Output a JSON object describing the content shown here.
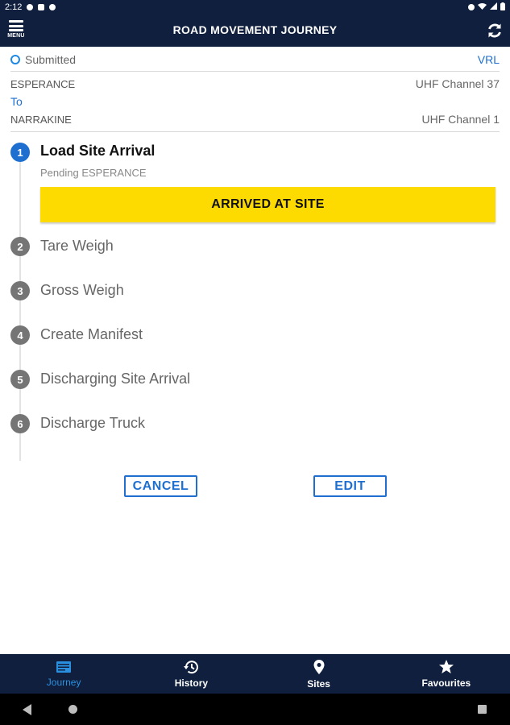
{
  "status_bar": {
    "time": "2:12"
  },
  "header": {
    "menu_label": "MENU",
    "title": "ROAD MOVEMENT JOURNEY"
  },
  "journey": {
    "status": "Submitted",
    "company": "VRL",
    "origin": "ESPERANCE",
    "origin_channel": "UHF Channel 37",
    "to_label": "To",
    "destination": "NARRAKINE",
    "destination_channel": "UHF Channel 1"
  },
  "steps": [
    {
      "number": "1",
      "title": "Load Site Arrival",
      "subtitle": "Pending ESPERANCE",
      "action": "ARRIVED AT SITE"
    },
    {
      "number": "2",
      "title": "Tare Weigh"
    },
    {
      "number": "3",
      "title": "Gross Weigh"
    },
    {
      "number": "4",
      "title": "Create Manifest"
    },
    {
      "number": "5",
      "title": "Discharging Site Arrival"
    },
    {
      "number": "6",
      "title": "Discharge Truck"
    }
  ],
  "actions": {
    "cancel_label": "CANCEL",
    "edit_label": "EDIT"
  },
  "bottom_nav": [
    {
      "label": "Journey",
      "icon": "journey-icon",
      "active": true
    },
    {
      "label": "History",
      "icon": "history-icon"
    },
    {
      "label": "Sites",
      "icon": "map-pin-icon"
    },
    {
      "label": "Favourites",
      "icon": "star-icon"
    }
  ],
  "colors": {
    "header_bg": "#0f1f3d",
    "accent_blue": "#1e6fd0",
    "action_yellow": "#fedb00",
    "step_pending": "#757575"
  }
}
